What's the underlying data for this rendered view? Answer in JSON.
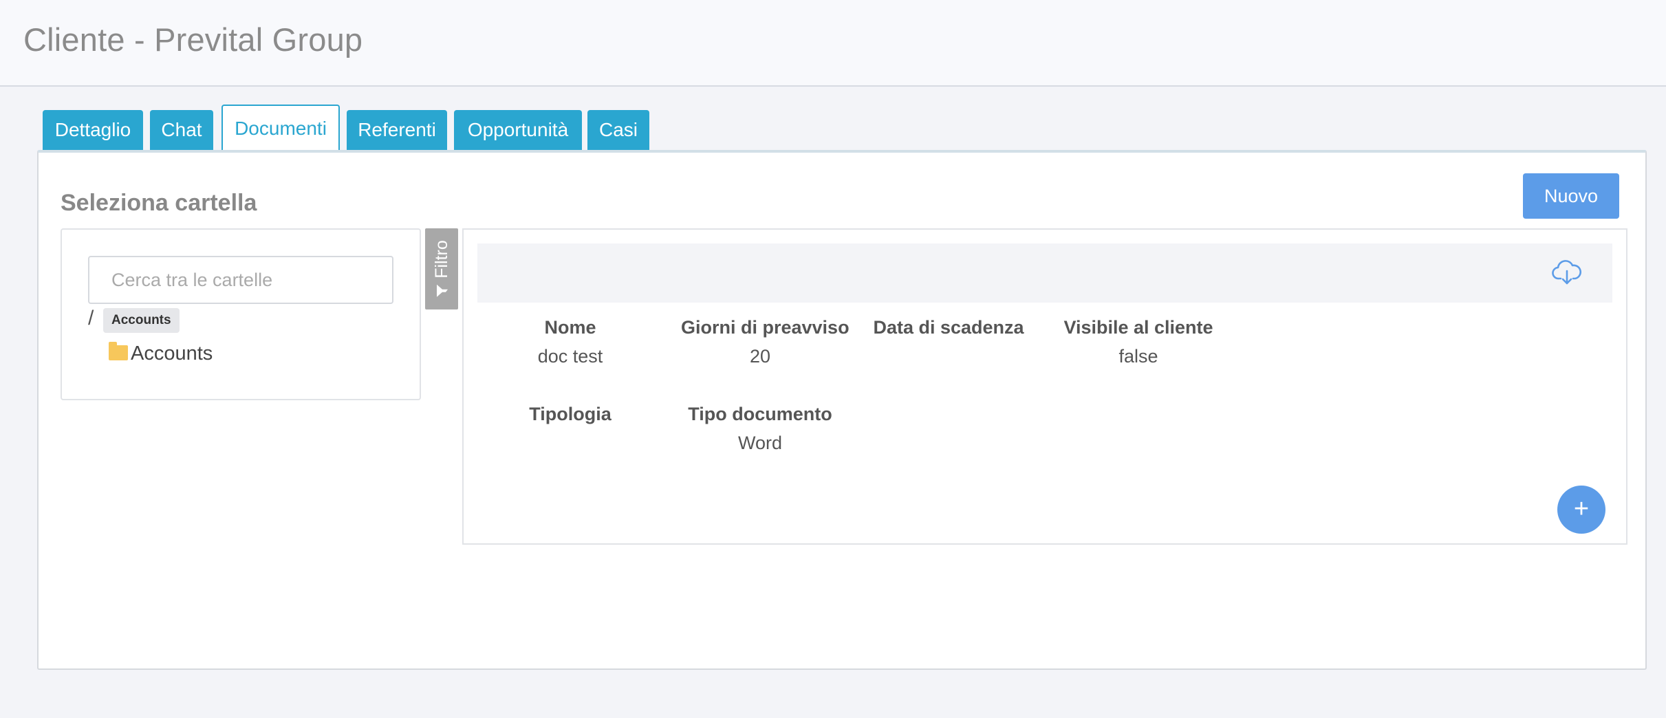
{
  "header": {
    "title": "Cliente - Prevital Group"
  },
  "tabs": [
    {
      "label": "Dettaglio",
      "active": false
    },
    {
      "label": "Chat",
      "active": false
    },
    {
      "label": "Documenti",
      "active": true
    },
    {
      "label": "Referenti",
      "active": false
    },
    {
      "label": "Opportunità",
      "active": false
    },
    {
      "label": "Casi",
      "active": false
    }
  ],
  "documents": {
    "section_title": "Seleziona cartella",
    "new_button_label": "Nuovo",
    "folder_search_placeholder": "Cerca tra le cartelle",
    "breadcrumb": {
      "separator": "/",
      "current": "Accounts"
    },
    "folders": [
      {
        "name": "Accounts",
        "icon": "folder-icon"
      }
    ],
    "filter_label": "Filtro",
    "download_icon": "cloud-download-icon",
    "add_button_label": "+",
    "fields": [
      {
        "label": "Nome",
        "value": "doc test"
      },
      {
        "label": "Giorni di preavviso",
        "value": "20"
      },
      {
        "label": "Data di scadenza",
        "value": ""
      },
      {
        "label": "Visibile al cliente",
        "value": "false"
      },
      {
        "label": "Tipologia",
        "value": ""
      },
      {
        "label": "Tipo documento",
        "value": "Word"
      }
    ]
  },
  "colors": {
    "tab_blue": "#2aa6d0",
    "button_blue": "#5c9ce8",
    "folder_yellow": "#f7c75b",
    "filter_gray": "#a8a8a8"
  }
}
